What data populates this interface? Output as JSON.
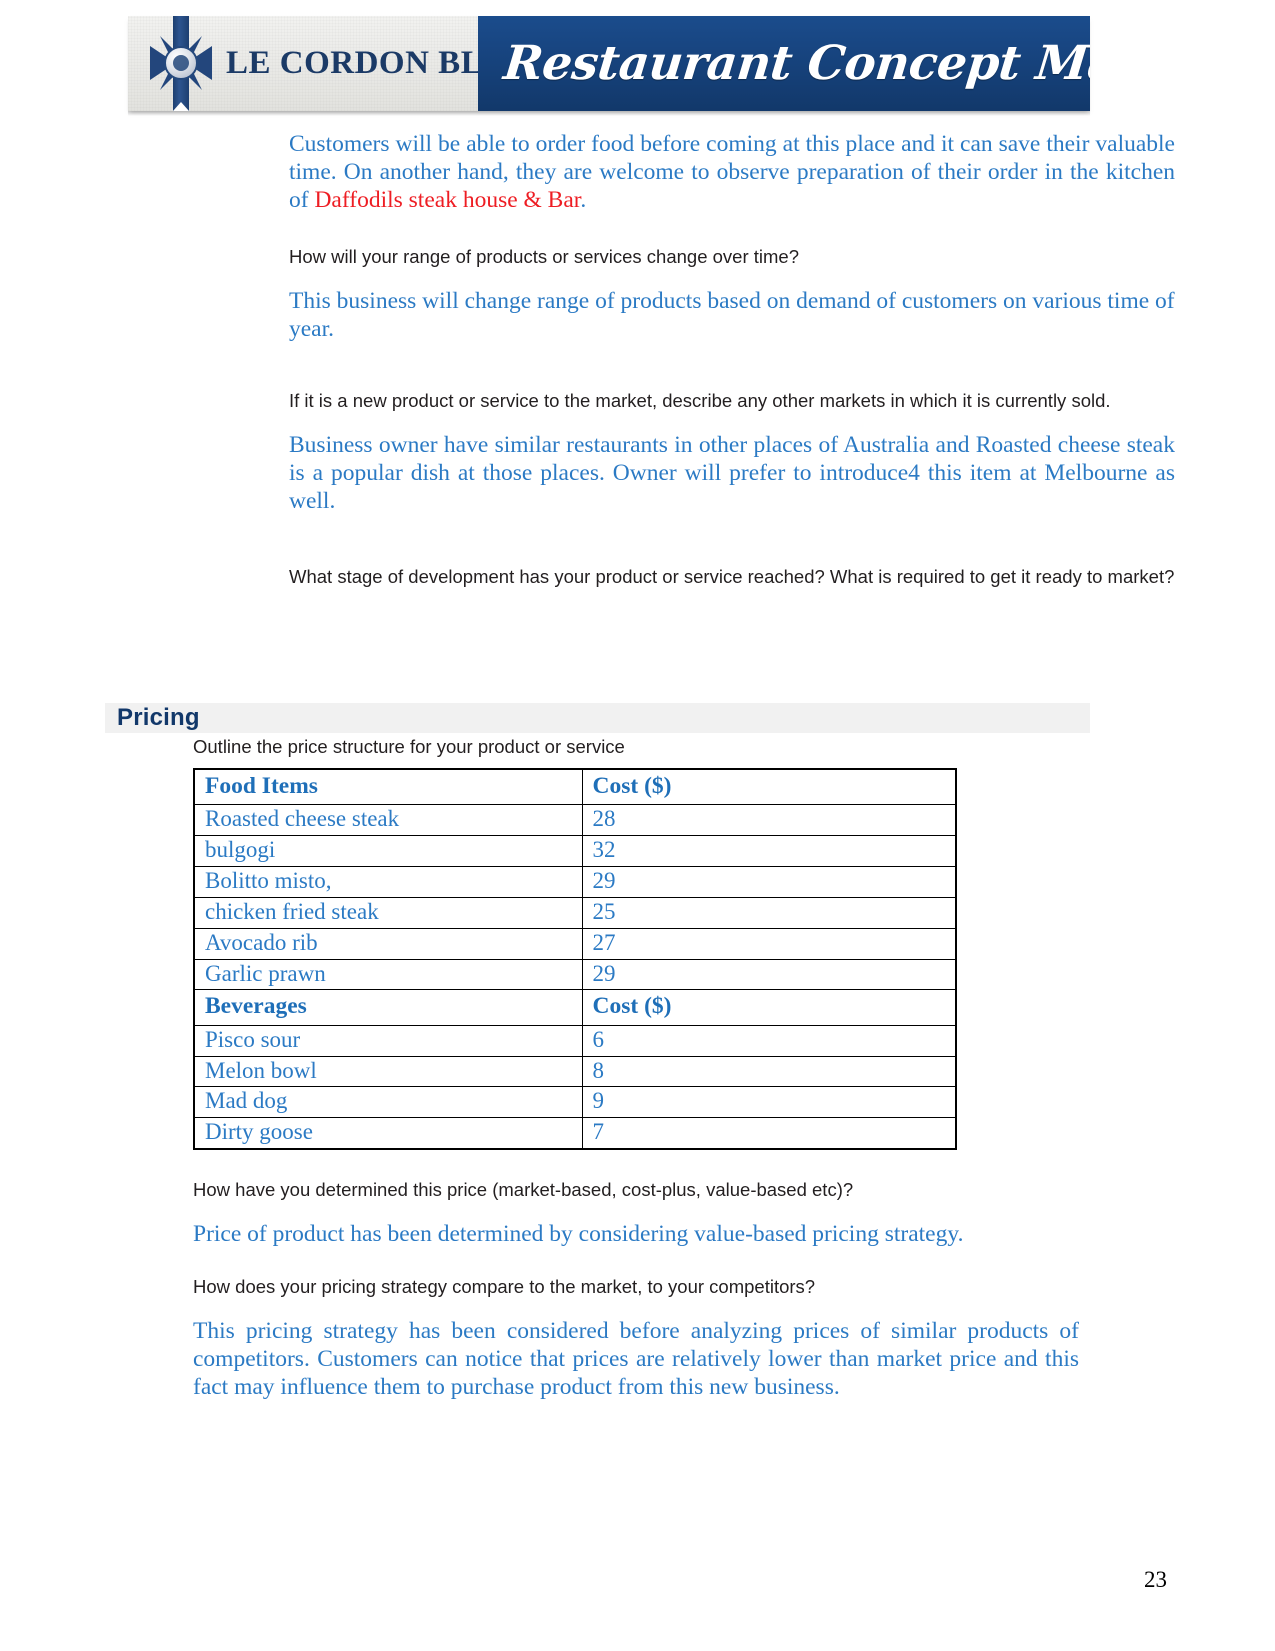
{
  "header": {
    "brand_name": "LE CORDON BLEU",
    "brand_registered_mark": "®",
    "banner_title": "Restaurant Concept Management",
    "colors": {
      "banner_blue": "#17447f",
      "brand_navy": "#1b3a66",
      "panel_gray": "#eaeae7"
    }
  },
  "document": {
    "answer_color": "#2b7ac4",
    "question_color": "#231f20",
    "highlight_color": "#ee1d23",
    "page_number": "23"
  },
  "body": {
    "intro_answer": {
      "text_before_highlight": "Customers will be able to order food before coming at this place and it can save their valuable time. On another hand, they are welcome to observe preparation of their order in the kitchen of ",
      "highlight": "Daffodils steak house & Bar",
      "text_after_highlight": "."
    },
    "qa": [
      {
        "question": "How will your range of products or services change over time?",
        "answer": "This business will change range of products based on demand of customers on various time of year."
      },
      {
        "question": "If it is a new product or service to the market, describe any other markets in which it is currently sold.",
        "answer": "Business owner have similar restaurants in other places of Australia and Roasted cheese steak is a popular dish at those places. Owner will prefer to introduce4 this item at Melbourne as well."
      },
      {
        "question": "What stage of development has your product or service reached?  What is required to get it ready to market?",
        "answer": ""
      }
    ]
  },
  "pricing": {
    "section_title": "Pricing",
    "intro_question": "Outline the price structure for your product or service",
    "table": {
      "food_header": [
        "Food Items",
        "Cost ($)"
      ],
      "food_rows": [
        [
          "Roasted cheese steak",
          "28"
        ],
        [
          "bulgogi",
          "32"
        ],
        [
          "Bolitto misto,",
          "29"
        ],
        [
          "chicken fried steak",
          "25"
        ],
        [
          "Avocado rib",
          "27"
        ],
        [
          "Garlic prawn",
          "29"
        ]
      ],
      "beverage_header": [
        "Beverages",
        "Cost ($)"
      ],
      "beverage_rows": [
        [
          "Pisco sour",
          "6"
        ],
        [
          "Melon bowl",
          "8"
        ],
        [
          "Mad dog",
          "9"
        ],
        [
          "Dirty goose",
          "7"
        ]
      ]
    },
    "qa": [
      {
        "question": "How have you determined this price (market-based, cost-plus, value-based etc)?",
        "answer": "Price of product has been determined by considering value-based pricing strategy."
      },
      {
        "question": "How does your pricing strategy compare to the market, to your competitors?",
        "answer": "This pricing strategy has been considered before analyzing prices of similar products of competitors. Customers can notice that prices are relatively lower than market price and this fact may influence them to purchase product from this new business."
      }
    ]
  }
}
